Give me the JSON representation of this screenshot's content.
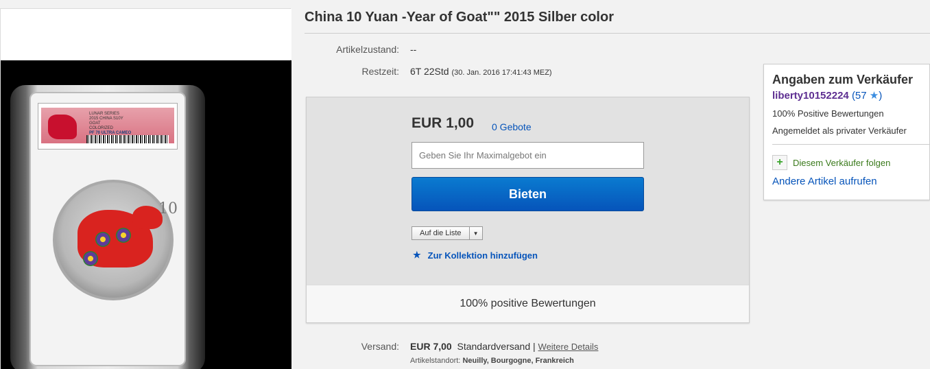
{
  "title": "China 10 Yuan -Year of Goat\"\" 2015 Silber color",
  "details": {
    "condition_label": "Artikelzustand:",
    "condition_value": "--",
    "time_label": "Restzeit:",
    "time_value": "6T 22Std",
    "time_end": "(30. Jan. 2016  17:41:43 MEZ)"
  },
  "image": {
    "label_lines": [
      "LUNAR SERIES",
      "2015 CHINA S10Y",
      "GOAT",
      "COLORIZED",
      "PF 70 ULTRA CAMEO"
    ],
    "coin_denomination": "10"
  },
  "bid": {
    "price": "EUR 1,00",
    "bids_link": "0 Gebote",
    "max_bid_placeholder": "Geben Sie Ihr Maximalgebot ein",
    "bid_button": "Bieten",
    "watch_label": "Auf die Liste",
    "collection_label": "Zur Kollektion hinzufügen",
    "footer": "100% positive Bewertungen"
  },
  "shipping": {
    "label": "Versand:",
    "price": "EUR 7,00",
    "method": "Standardversand |",
    "details_link": "Weitere Details",
    "location_label": "Artikelstandort:",
    "location_value": "Neuilly, Bourgogne, Frankreich"
  },
  "seller": {
    "heading": "Angaben zum Verkäufer",
    "username": "liberty10152224",
    "score_open": "(57",
    "score_close": ")",
    "positive": "100% Positive Bewertungen",
    "type": "Angemeldet als privater Verkäufer",
    "follow": "Diesem Verkäufer folgen",
    "other_items": "Andere Artikel aufrufen"
  },
  "colors": {
    "link": "#0654ba",
    "button": "#0654ba",
    "username": "#5d2e91",
    "follow": "#3a7a1b"
  }
}
